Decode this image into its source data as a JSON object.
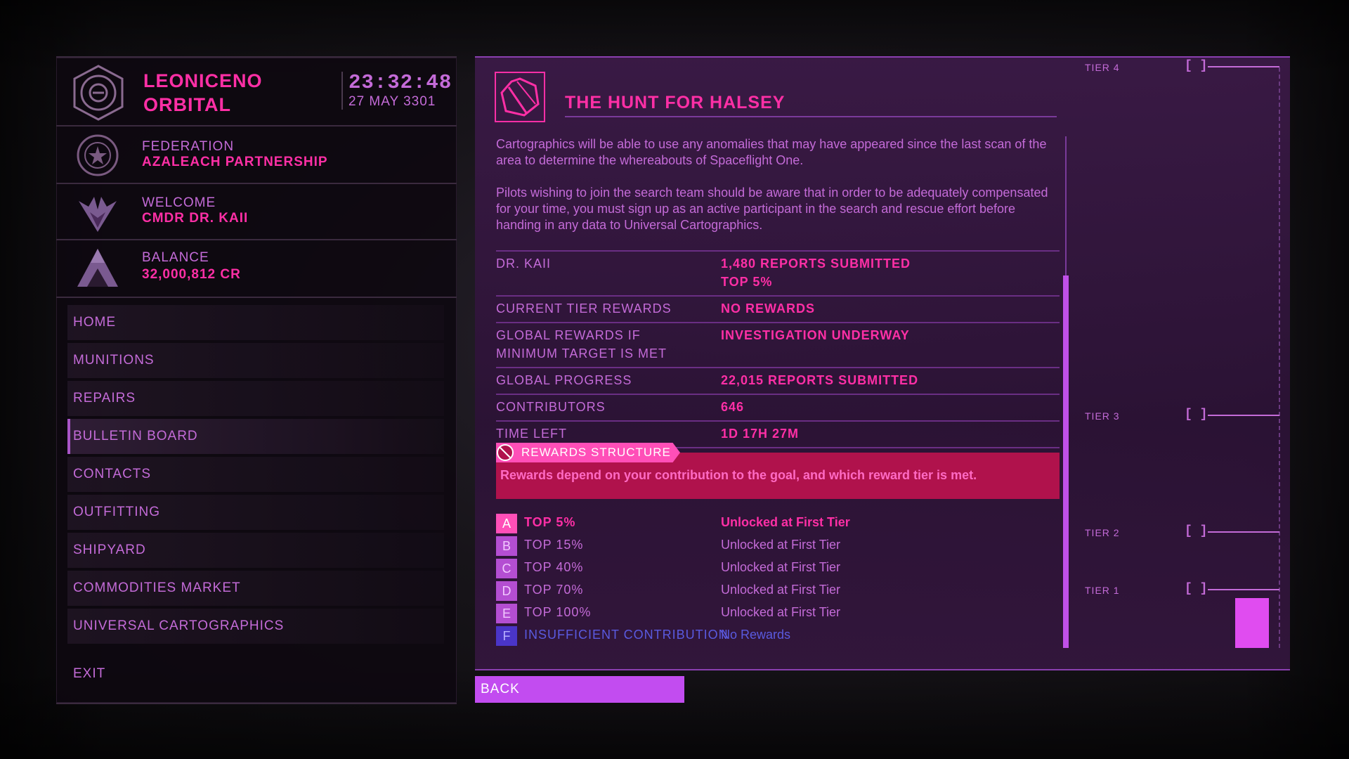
{
  "station": {
    "name": "LEONICENO ORBITAL",
    "time": "23:32:48",
    "date": "27 MAY 3301",
    "faction_label": "FEDERATION",
    "faction_name": "AZALEACH PARTNERSHIP",
    "welcome_label": "WELCOME",
    "commander": "CMDR DR. KAII",
    "balance_label": "BALANCE",
    "balance": "32,000,812 CR"
  },
  "nav": {
    "items": [
      {
        "label": "HOME"
      },
      {
        "label": "MUNITIONS"
      },
      {
        "label": "REPAIRS"
      },
      {
        "label": "BULLETIN BOARD"
      },
      {
        "label": "CONTACTS"
      },
      {
        "label": "OUTFITTING"
      },
      {
        "label": "SHIPYARD"
      },
      {
        "label": "COMMODITIES MARKET"
      },
      {
        "label": "UNIVERSAL CARTOGRAPHICS"
      }
    ],
    "active": "BULLETIN BOARD",
    "exit": "EXIT"
  },
  "mission": {
    "title": "THE HUNT FOR HALSEY",
    "paragraphs": [
      "Cartographics will be able to use any anomalies that may have appeared since the last scan of the area to determine the whereabouts of Spaceflight One.",
      "Pilots wishing to join the search team should be aware that in order to be adequately compensated for your time, you must sign up as an active participant in the search and rescue effort before handing in any data to Universal Cartographics."
    ],
    "stats": [
      {
        "key": "DR. KAII",
        "values": [
          "1,480 REPORTS SUBMITTED",
          "TOP 5%"
        ]
      },
      {
        "key": "CURRENT TIER REWARDS",
        "values": [
          "NO REWARDS"
        ]
      },
      {
        "key": "GLOBAL REWARDS IF MINIMUM TARGET IS MET",
        "values": [
          "INVESTIGATION UNDERWAY"
        ]
      },
      {
        "key": "GLOBAL PROGRESS",
        "values": [
          "22,015 REPORTS SUBMITTED"
        ]
      },
      {
        "key": "CONTRIBUTORS",
        "values": [
          "646"
        ]
      },
      {
        "key": "TIME LEFT",
        "values": [
          "1D 17H 27M"
        ]
      }
    ],
    "rewards_tab": "REWARDS STRUCTURE",
    "rewards_note": "Rewards depend on your contribution to the goal, and which reward tier is met.",
    "reward_rows": [
      {
        "letter": "A",
        "bracket": "TOP 5%",
        "result": "Unlocked at First Tier"
      },
      {
        "letter": "B",
        "bracket": "TOP 15%",
        "result": "Unlocked at First Tier"
      },
      {
        "letter": "C",
        "bracket": "TOP 40%",
        "result": "Unlocked at First Tier"
      },
      {
        "letter": "D",
        "bracket": "TOP 70%",
        "result": "Unlocked at First Tier"
      },
      {
        "letter": "E",
        "bracket": "TOP 100%",
        "result": "Unlocked at First Tier"
      },
      {
        "letter": "F",
        "bracket": "INSUFFICIENT CONTRIBUTION",
        "result": "No Rewards"
      }
    ]
  },
  "tier_chart": {
    "tiers": [
      {
        "label": "TIER 4",
        "bracket": "[ ]"
      },
      {
        "label": "TIER 3",
        "bracket": "[ ]"
      },
      {
        "label": "TIER 2",
        "bracket": "[ ]"
      },
      {
        "label": "TIER 1",
        "bracket": "[ ]"
      }
    ],
    "progress_fraction_of_tier1": 0.85
  },
  "back_button": "BACK",
  "colors": {
    "accent_pink": "#ff2fa6",
    "text_purple": "#c46bd8",
    "panel_purple": "#3c1a48",
    "button_purple": "#c24cf0",
    "alert_red": "#b0124c"
  },
  "icons": {
    "station": "station-logo-icon",
    "faction": "federation-emblem-icon",
    "rank": "rank-wings-icon",
    "balance": "credits-pyramid-icon",
    "mission": "cartographics-compass-icon"
  }
}
